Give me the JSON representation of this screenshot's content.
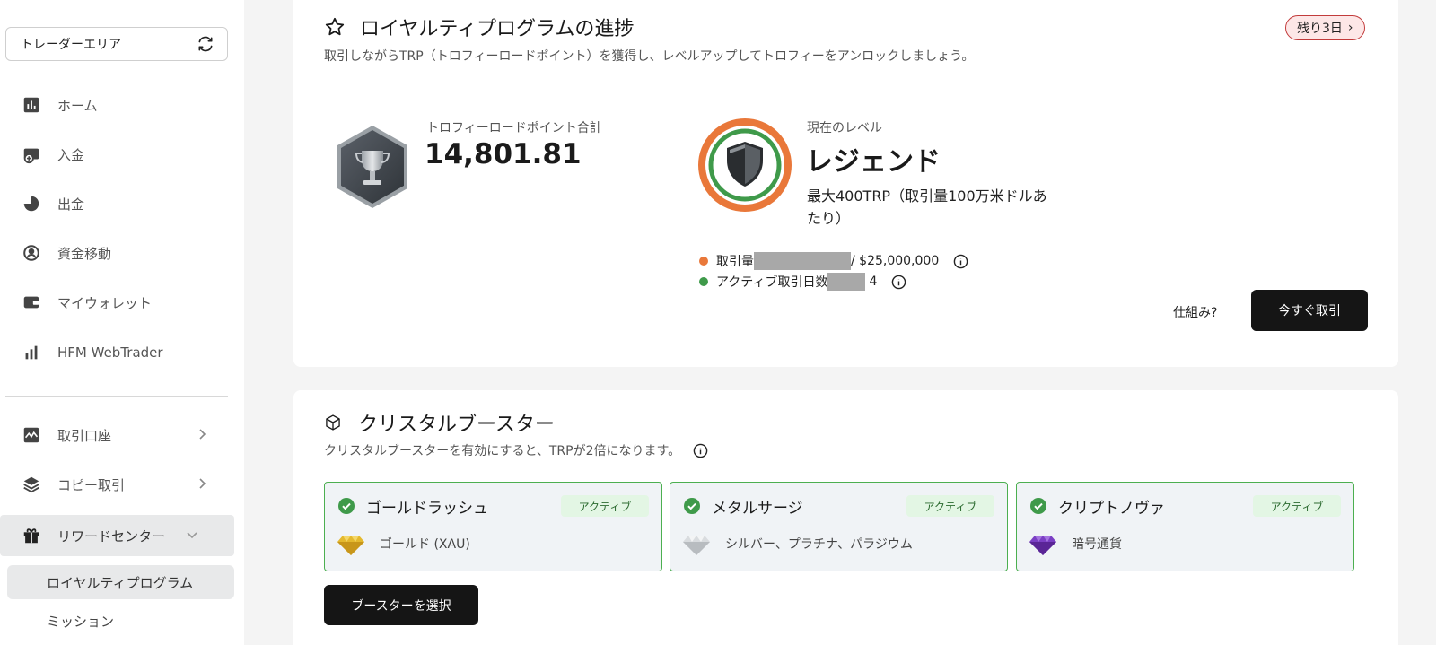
{
  "sidebar": {
    "area_label": "トレーダーエリア",
    "items": [
      {
        "label": "ホーム"
      },
      {
        "label": "入金"
      },
      {
        "label": "出金"
      },
      {
        "label": "資金移動"
      },
      {
        "label": "マイウォレット"
      },
      {
        "label": "HFM WebTrader"
      },
      {
        "label": "取引口座"
      },
      {
        "label": "コピー取引"
      },
      {
        "label": "リワードセンター"
      }
    ],
    "sub_items": [
      {
        "label": "ロイヤルティプログラム"
      },
      {
        "label": "ミッション"
      }
    ]
  },
  "loyalty": {
    "title": "ロイヤルティプログラムの進捗",
    "description": "取引しながらTRP（トロフィーロードポイント）を獲得し、レベルアップしてトロフィーをアンロックしましょう。",
    "remaining": "残り3日",
    "points_label": "トロフィーロードポイント合計",
    "points_value": "14,801.81",
    "level_label": "現在のレベル",
    "level_value": "レジェンド",
    "level_detail": "最大400TRP（取引量100万米ドルあたり）",
    "volume_label": "取引量",
    "volume_target": "/ $25,000,000",
    "days_label": "アクティブ取引日数",
    "days_value": "4",
    "how_link": "仕組み?",
    "trade_button": "今すぐ取引"
  },
  "booster": {
    "title": "クリスタルブースター",
    "description": "クリスタルブースターを有効にすると、TRPが2倍になります。",
    "items": [
      {
        "name": "ゴールドラッシュ",
        "status": "アクティブ",
        "desc": "ゴールド (XAU)"
      },
      {
        "name": "メタルサージ",
        "status": "アクティブ",
        "desc": "シルバー、プラチナ、パラジウム"
      },
      {
        "name": "クリプトノヴァ",
        "status": "アクティブ",
        "desc": "暗号通貨"
      }
    ],
    "select_button": "ブースターを選択"
  },
  "colors": {
    "accent_orange": "#e9783a",
    "accent_green": "#3f9a4a",
    "dark_button": "#151515",
    "active_badge_bg": "#e3f6e4"
  }
}
